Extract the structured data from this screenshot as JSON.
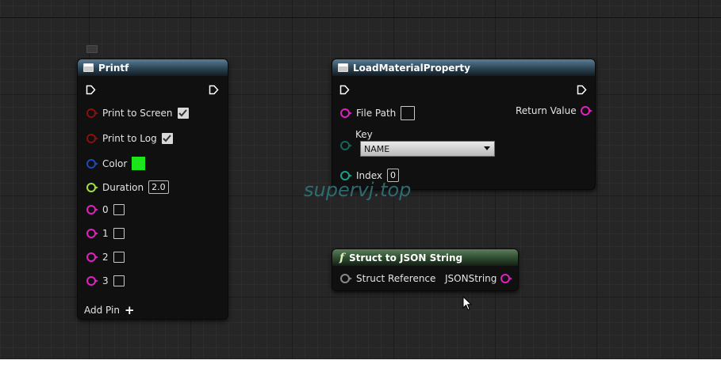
{
  "watermark": "supervj.top",
  "printf": {
    "title": "Printf",
    "print_to_screen": "Print to Screen",
    "print_to_log": "Print to Log",
    "color_label": "Color",
    "color_value": "#1ae61a",
    "duration_label": "Duration",
    "duration_value": "2.0",
    "pins": [
      "0",
      "1",
      "2",
      "3"
    ],
    "add_pin": "Add Pin"
  },
  "load_material": {
    "title": "LoadMaterialProperty",
    "file_path": "File Path",
    "return_value": "Return Value",
    "key_label": "Key",
    "key_selected": "NAME",
    "index_label": "Index",
    "index_value": "0"
  },
  "struct_json": {
    "title": "Struct to JSON String",
    "input": "Struct Reference",
    "output": "JSONString"
  }
}
